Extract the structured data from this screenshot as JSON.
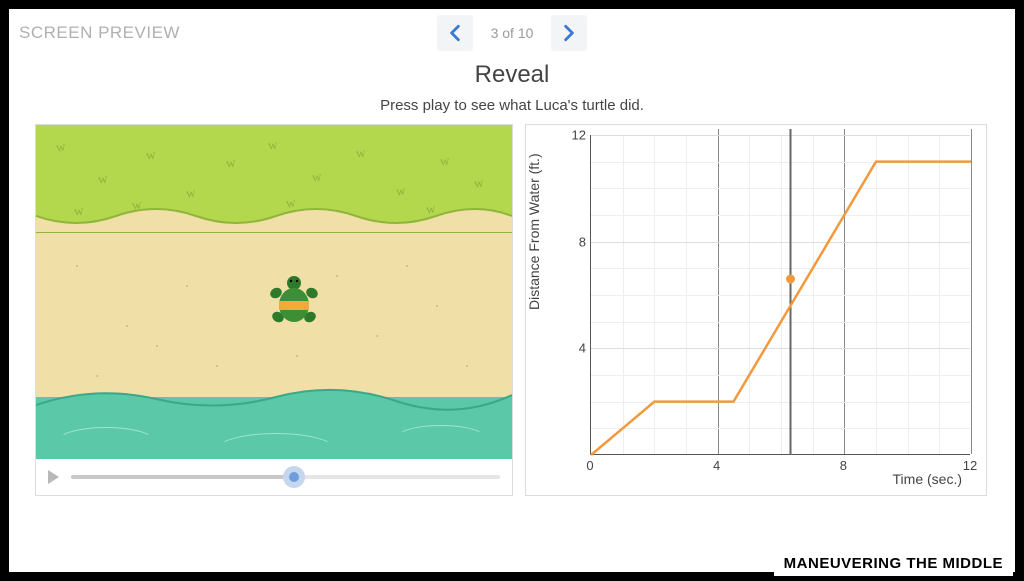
{
  "header": {
    "preview_label": "SCREEN PREVIEW",
    "page_indicator": "3 of 10"
  },
  "title": "Reveal",
  "subtitle": "Press play to see what Luca's turtle did.",
  "playback": {
    "position_pct": 52
  },
  "chart_data": {
    "type": "line",
    "title": "",
    "xlabel": "Time (sec.)",
    "ylabel": "Distance From Water (ft.)",
    "xlim": [
      0,
      12
    ],
    "ylim": [
      0,
      12
    ],
    "x_ticks": [
      0,
      4,
      8,
      12
    ],
    "y_ticks": [
      4,
      8,
      12
    ],
    "series": [
      {
        "name": "turtle",
        "points": [
          [
            0,
            0
          ],
          [
            2,
            2
          ],
          [
            4.5,
            2
          ],
          [
            9,
            11
          ],
          [
            12,
            11
          ]
        ]
      }
    ],
    "current_time": 6.3,
    "current_value": 6.6
  },
  "brand": "MANEUVERING THE MIDDLE"
}
